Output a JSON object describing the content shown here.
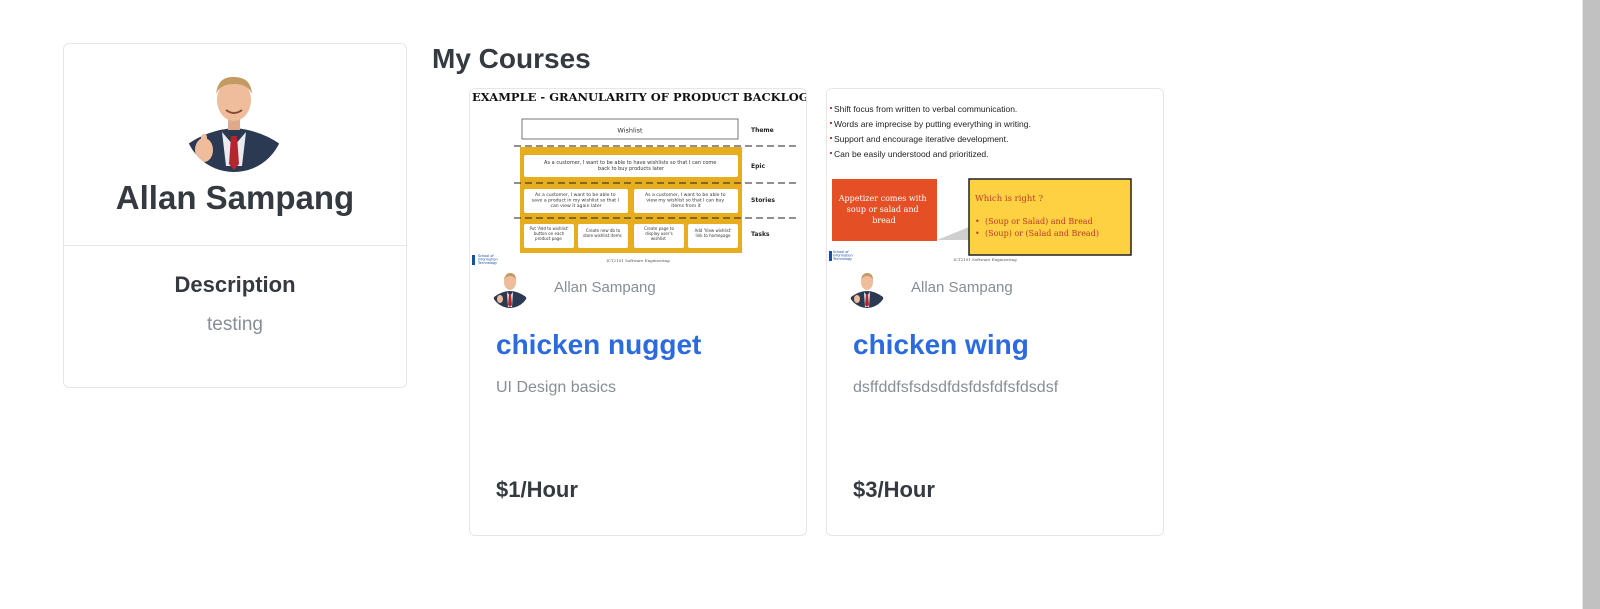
{
  "profile": {
    "name": "Allan Sampang",
    "description_title": "Description",
    "description": "testing"
  },
  "main": {
    "section_title": "My Courses"
  },
  "courses": [
    {
      "thumbnail": {
        "heading": "EXAMPLE - GRANULARITY OF PRODUCT BACKLOG ITEMS",
        "wishlist_label": "Wishlist",
        "rows": [
          "Theme",
          "Epic",
          "Stories",
          "Tasks"
        ],
        "epic_text": "As a customer, I want to be able to have wishlists so that I can come back to buy products later",
        "story_1": "As a customer, I want to be able to save a product in my wishlist so that I can view it again later",
        "story_2": "As a customer, I want to be able to view my wishlist so that I can buy items from it",
        "tasks": [
          "Put 'Add to wishlist' button on each product page",
          "Create new db to store wishlist items",
          "Create page to display user's wishlist",
          "Add 'View wishlist' link to homepage"
        ],
        "school_label": "School of Information Technology",
        "footer": "ICT2101 Software Engineering"
      },
      "author": "Allan Sampang",
      "title": "chicken nugget",
      "description": "UI Design basics",
      "price": "$1/Hour"
    },
    {
      "thumbnail": {
        "bullets": [
          "Shift focus from written to verbal communication.",
          "Words are imprecise by putting everything in writing.",
          "Support and encourage iterative development.",
          "Can be easily understood and prioritized."
        ],
        "left_box": "Appetizer comes with soup or salad and bread",
        "right_title": "Which is right ?",
        "right_items": [
          "(Soup or Salad) and Bread",
          "(Soup) or (Salad and Bread)"
        ],
        "school_label": "School of Information Technology",
        "footer": "ICT2101 Software Engineering"
      },
      "author": "Allan Sampang",
      "title": "chicken wing",
      "description": "dsffddfsfsdsdfdsfdsfdfsfdsdsf",
      "price": "$3/Hour"
    }
  ],
  "colors": {
    "link": "#2c6ae0",
    "muted": "#868e96",
    "text": "#343a40",
    "gold": "#e6ae1e",
    "orange": "#e44f26",
    "yellow": "#fed143"
  }
}
